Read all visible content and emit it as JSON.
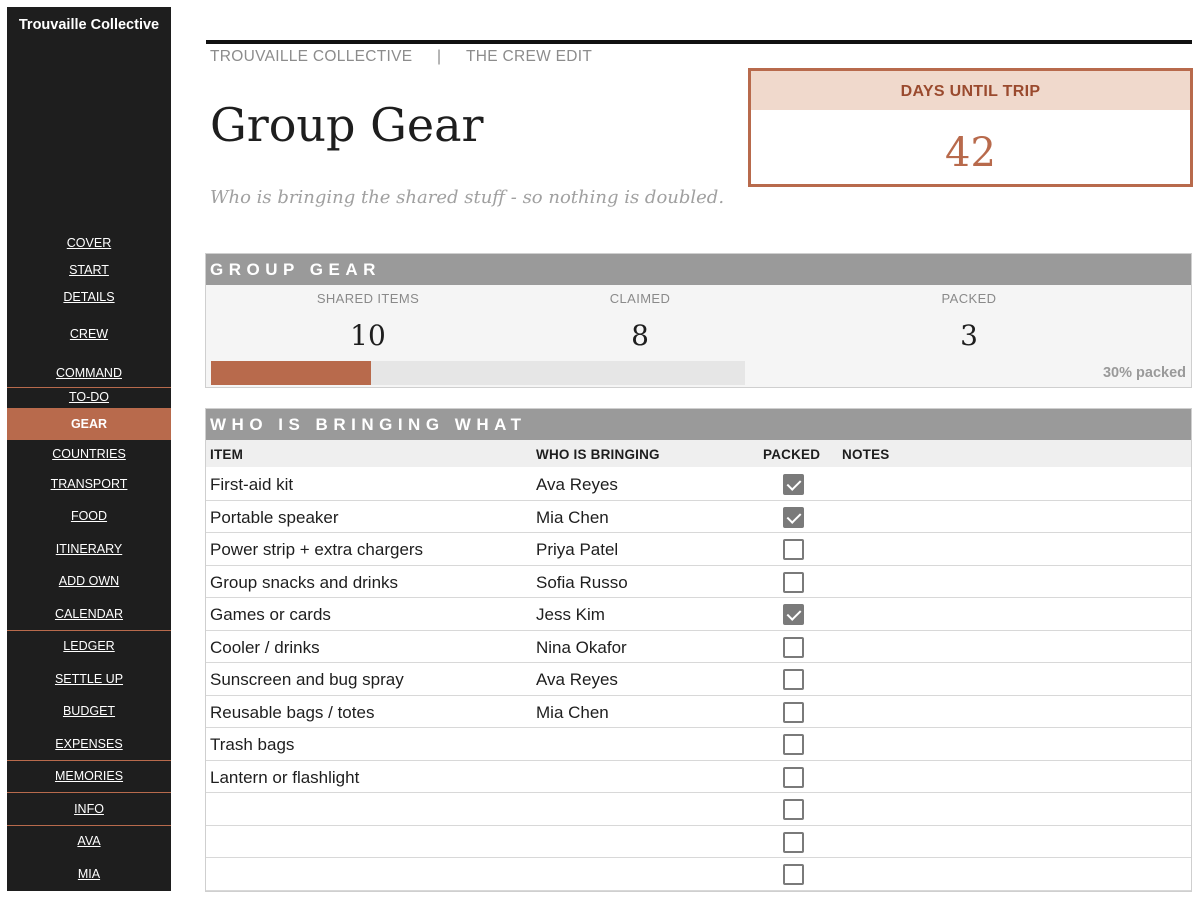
{
  "sidebar": {
    "brand": "Trouvaille Collective",
    "items": [
      {
        "label": "COVER"
      },
      {
        "label": "START"
      },
      {
        "label": "DETAILS"
      },
      {
        "label": "CREW"
      },
      {
        "label": "COMMAND"
      },
      {
        "label": "TO-DO"
      },
      {
        "label": "GEAR",
        "active": true
      },
      {
        "label": "COUNTRIES"
      },
      {
        "label": "TRANSPORT"
      },
      {
        "label": "FOOD"
      },
      {
        "label": "ITINERARY"
      },
      {
        "label": "ADD OWN"
      },
      {
        "label": "CALENDAR"
      },
      {
        "label": "LEDGER"
      },
      {
        "label": "SETTLE UP"
      },
      {
        "label": "BUDGET"
      },
      {
        "label": "EXPENSES"
      },
      {
        "label": "MEMORIES"
      },
      {
        "label": "INFO"
      },
      {
        "label": "AVA"
      },
      {
        "label": "MIA"
      }
    ]
  },
  "header": {
    "breadcrumb": [
      "TROUVAILLE COLLECTIVE",
      "|",
      "THE CREW EDIT"
    ],
    "title": "Group Gear",
    "subtitle": "Who is bringing the shared stuff - so nothing is doubled."
  },
  "days_card": {
    "label": "DAYS UNTIL TRIP",
    "value": "42"
  },
  "summary": {
    "header": "GROUP GEAR",
    "stats": [
      {
        "label": "SHARED ITEMS",
        "value": "10"
      },
      {
        "label": "CLAIMED",
        "value": "8"
      },
      {
        "label": "PACKED",
        "value": "3"
      }
    ],
    "progress_fraction": 0.3,
    "packed_label": "30% packed"
  },
  "table": {
    "header": "WHO IS BRINGING WHAT",
    "columns": [
      "ITEM",
      "WHO IS BRINGING",
      "PACKED",
      "NOTES"
    ],
    "rows": [
      {
        "item": "First-aid kit",
        "who": "Ava Reyes",
        "packed": true
      },
      {
        "item": "Portable speaker",
        "who": "Mia Chen",
        "packed": true
      },
      {
        "item": "Power strip + extra chargers",
        "who": "Priya Patel",
        "packed": false
      },
      {
        "item": "Group snacks and drinks",
        "who": "Sofia Russo",
        "packed": false
      },
      {
        "item": "Games or cards",
        "who": "Jess Kim",
        "packed": true
      },
      {
        "item": "Cooler / drinks",
        "who": "Nina Okafor",
        "packed": false
      },
      {
        "item": "Sunscreen and bug spray",
        "who": "Ava Reyes",
        "packed": false
      },
      {
        "item": "Reusable bags / totes",
        "who": "Mia Chen",
        "packed": false
      },
      {
        "item": "Trash bags",
        "who": "",
        "packed": false
      },
      {
        "item": "Lantern or flashlight",
        "who": "",
        "packed": false
      },
      {
        "item": "",
        "who": "",
        "packed": false
      },
      {
        "item": "",
        "who": "",
        "packed": false
      },
      {
        "item": "",
        "who": "",
        "packed": false
      }
    ]
  }
}
